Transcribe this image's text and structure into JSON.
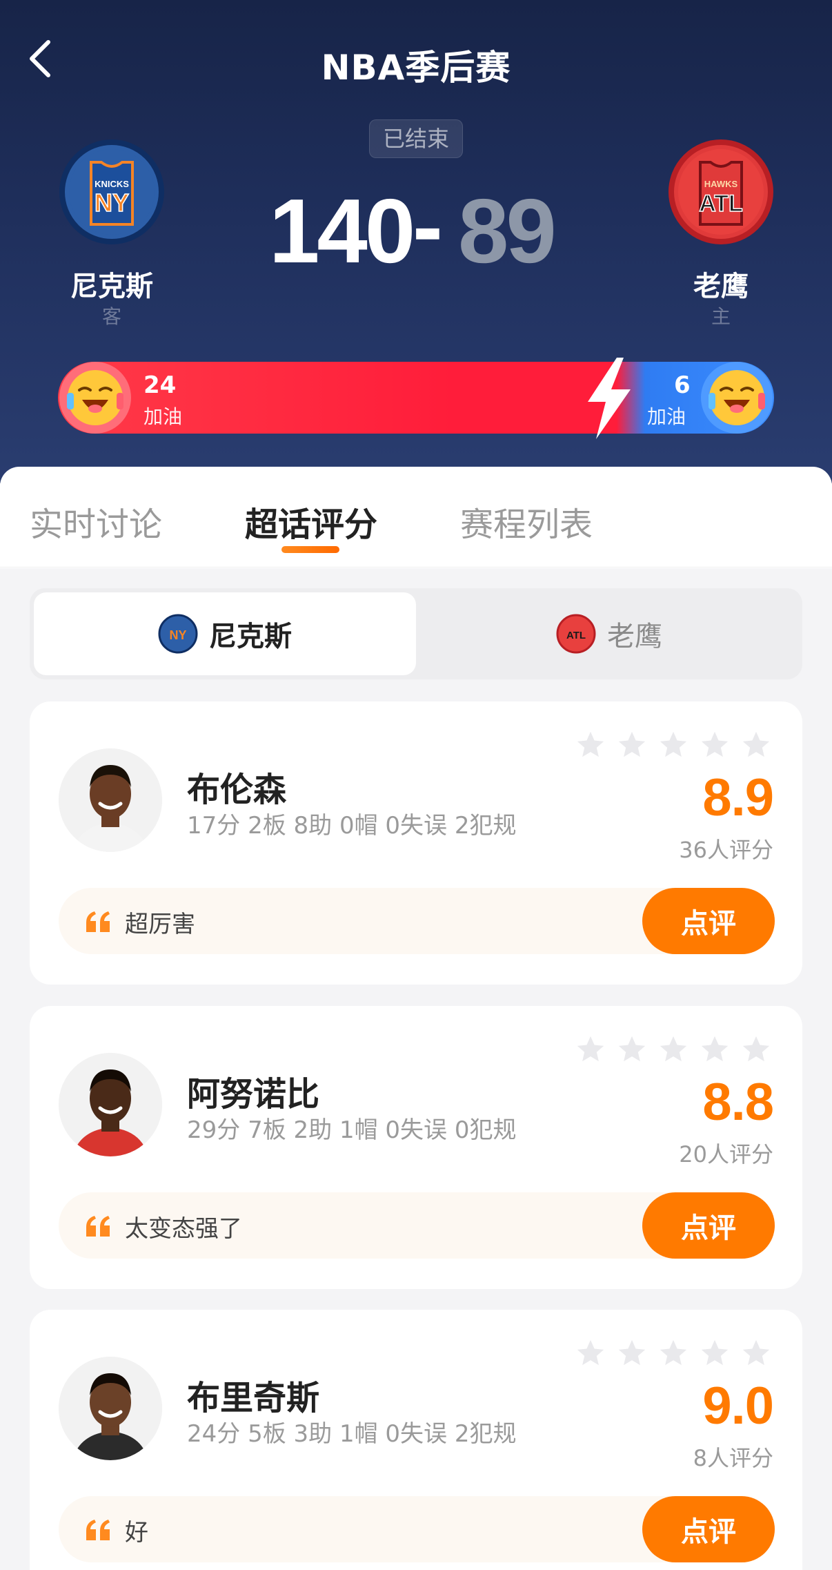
{
  "header": {
    "title": "NBA季后赛",
    "status": "已结束",
    "away": {
      "name": "尼克斯",
      "side": "客",
      "score": "140",
      "logo_text": "NY",
      "logo_sub": "KNICKS"
    },
    "home": {
      "name": "老鹰",
      "side": "主",
      "score": "89",
      "logo_text": "ATL",
      "logo_sub": "HAWKS"
    },
    "score_separator": "-",
    "cheer": {
      "away_count": "24",
      "away_label": "加油",
      "home_count": "6",
      "home_label": "加油"
    }
  },
  "tabs": [
    {
      "label": "实时讨论"
    },
    {
      "label": "超话评分",
      "active": true
    },
    {
      "label": "赛程列表"
    }
  ],
  "team_switch": {
    "active": "尼克斯",
    "inactive": "老鹰"
  },
  "players": [
    {
      "name": "布伦森",
      "stats": "17分  2板  8助  0帽  0失误  2犯规",
      "rating": "8.9",
      "rating_count": "36人评分",
      "top_comment": "超厉害",
      "review_label": "点评"
    },
    {
      "name": "阿努诺比",
      "stats": "29分  7板  2助  1帽  0失误  0犯规",
      "rating": "8.8",
      "rating_count": "20人评分",
      "top_comment": "太变态强了",
      "review_label": "点评"
    },
    {
      "name": "布里奇斯",
      "stats": "24分  5板  3助  1帽  0失误  2犯规",
      "rating": "9.0",
      "rating_count": "8人评分",
      "top_comment": "好",
      "review_label": "点评"
    }
  ],
  "colors": {
    "accent": "#ff7a00",
    "header_bg": "#1f2f5c",
    "cheer_red": "#ff1d3a",
    "cheer_blue": "#3b8cff"
  }
}
